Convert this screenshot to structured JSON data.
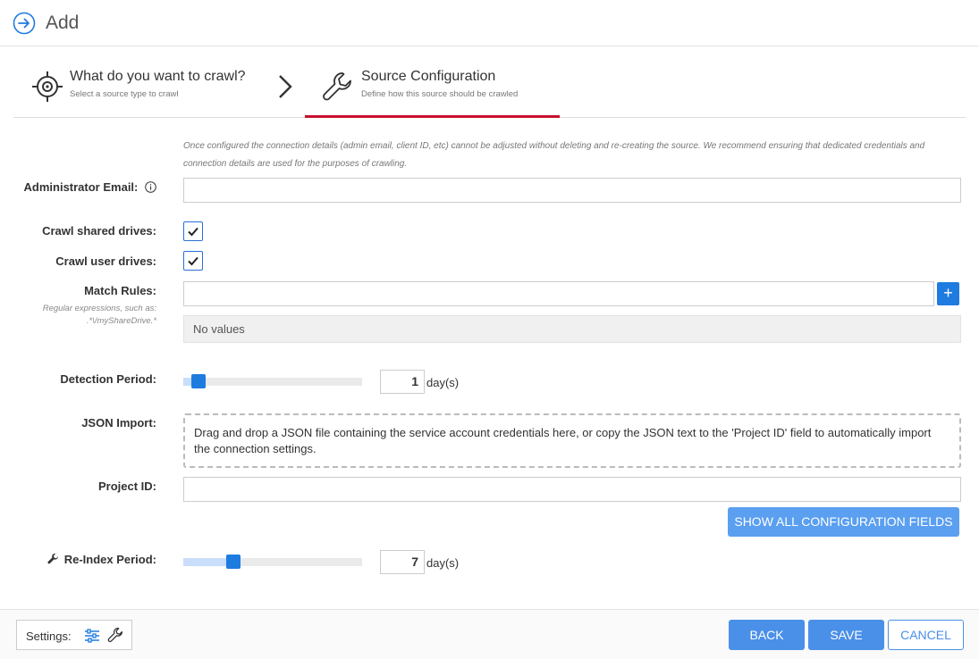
{
  "header": {
    "title": "Add"
  },
  "steps": [
    {
      "title": "What do you want to crawl?",
      "subtitle": "Select a source type to crawl"
    },
    {
      "title": "Source Configuration",
      "subtitle": "Define how this source should be crawled"
    }
  ],
  "notice": "Once configured the connection details (admin email, client ID, etc) cannot be adjusted without deleting and re-creating the source. We recommend ensuring that dedicated credentials and connection details are used for the purposes of crawling.",
  "form": {
    "admin_email": {
      "label": "Administrator Email:",
      "value": ""
    },
    "crawl_shared": {
      "label": "Crawl shared drives:",
      "checked": true
    },
    "crawl_user": {
      "label": "Crawl user drives:",
      "checked": true
    },
    "match_rules": {
      "label": "Match Rules:",
      "hint": "Regular expressions, such as: .*\\/myShareDrive.*",
      "value": "",
      "add_label": "+",
      "empty_text": "No values"
    },
    "detection_period": {
      "label": "Detection Period:",
      "value": "1",
      "unit": "day(s)",
      "fraction": 0.05
    },
    "json_import": {
      "label": "JSON Import:",
      "text": "Drag and drop a JSON file containing the service account credentials here, or copy the JSON text to the 'Project ID' field to automatically import the connection settings."
    },
    "project_id": {
      "label": "Project ID:",
      "value": ""
    },
    "show_all_label": "SHOW ALL CONFIGURATION FIELDS",
    "reindex_period": {
      "label": "Re-Index Period:",
      "value": "7",
      "unit": "day(s)",
      "fraction": 0.26
    }
  },
  "footer": {
    "settings_label": "Settings:",
    "back_label": "BACK",
    "save_label": "SAVE",
    "cancel_label": "CANCEL"
  },
  "colors": {
    "accent": "#1e7be0",
    "step_underline": "#c8102e"
  }
}
